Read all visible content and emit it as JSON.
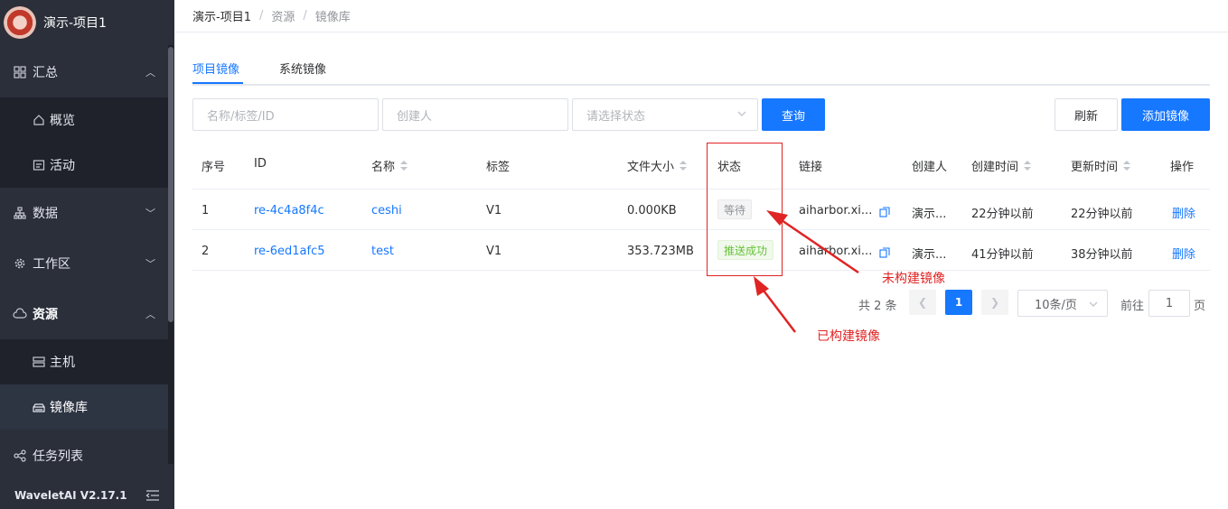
{
  "app": {
    "project_name": "演示-项目1",
    "version": "WaveletAI V2.17.1"
  },
  "sidebar": {
    "items": [
      {
        "label": "汇总",
        "icon": "grid-icon"
      },
      {
        "label": "概览",
        "icon": "home-icon"
      },
      {
        "label": "活动",
        "icon": "activity-icon"
      },
      {
        "label": "数据",
        "icon": "data-tree-icon"
      },
      {
        "label": "工作区",
        "icon": "gear-icon"
      },
      {
        "label": "资源",
        "icon": "cloud-icon"
      },
      {
        "label": "主机",
        "icon": "server-icon"
      },
      {
        "label": "镜像库",
        "icon": "image-repo-icon"
      },
      {
        "label": "任务列表",
        "icon": "task-icon"
      }
    ]
  },
  "breadcrumb": [
    "演示-项目1",
    "资源",
    "镜像库"
  ],
  "tabs": [
    "项目镜像",
    "系统镜像"
  ],
  "filters": {
    "name_placeholder": "名称/标签/ID",
    "creator_placeholder": "创建人",
    "status_placeholder": "请选择状态",
    "query_label": "查询",
    "refresh_label": "刷新",
    "add_label": "添加镜像"
  },
  "table": {
    "headers": [
      "序号",
      "ID",
      "名称",
      "标签",
      "文件大小",
      "状态",
      "链接",
      "创建人",
      "创建时间",
      "更新时间",
      "操作"
    ],
    "rows": [
      {
        "index": "1",
        "id": "re-4c4a8f4c",
        "name": "ceshi",
        "tag": "V1",
        "size": "0.000KB",
        "status": "等待",
        "link": "aiharbor.xi...",
        "creator": "演示...",
        "created": "22分钟以前",
        "updated": "22分钟以前",
        "action": "删除"
      },
      {
        "index": "2",
        "id": "re-6ed1afc5",
        "name": "test",
        "tag": "V1",
        "size": "353.723MB",
        "status": "推送成功",
        "link": "aiharbor.xi...",
        "creator": "演示...",
        "created": "41分钟以前",
        "updated": "38分钟以前",
        "action": "删除"
      }
    ]
  },
  "annotations": {
    "unbuilt": "未构建镜像",
    "built": "已构建镜像"
  },
  "pagination": {
    "total": "共 2 条",
    "current": "1",
    "page_size": "10条/页",
    "goto_label": "前往",
    "goto_value": "1",
    "page_unit": "页"
  },
  "colors": {
    "accent": "#1677ff",
    "sidebar": "#2b2f3a",
    "annotation": "#e02424",
    "success": "#67c23a"
  }
}
